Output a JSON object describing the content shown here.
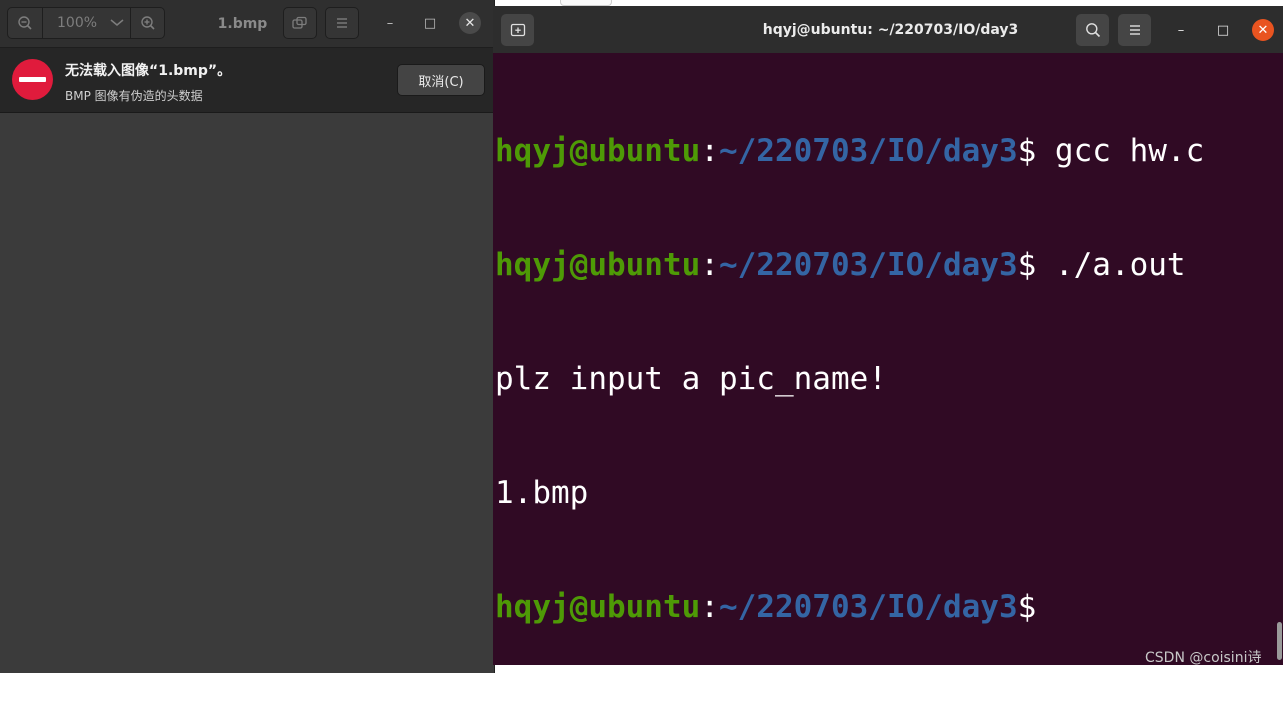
{
  "viewer": {
    "zoom_level": "100%",
    "title": "1.bmp",
    "error": {
      "title": "无法载入图像“1.bmp”。",
      "message": "BMP 图像有伪造的头数据",
      "cancel_label": "取消(C)"
    },
    "controls": {
      "minimize": "–",
      "maximize": "□",
      "close": "✕"
    }
  },
  "terminal": {
    "title": "hqyj@ubuntu: ~/220703/IO/day3",
    "prompt_user": "hqyj@ubuntu",
    "prompt_colon": ":",
    "prompt_path": "~/220703/IO/day3",
    "lines": [
      {
        "type": "prompt",
        "cmd": "$ gcc hw.c"
      },
      {
        "type": "prompt",
        "cmd": "$ ./a.out"
      },
      {
        "type": "output",
        "text": "plz input a pic_name!"
      },
      {
        "type": "output",
        "text": "1.bmp"
      },
      {
        "type": "prompt",
        "cmd": "$"
      }
    ],
    "controls": {
      "minimize": "–",
      "maximize": "□",
      "close": "✕"
    }
  },
  "watermark": "CSDN @coisini诗",
  "colors": {
    "terminal_bg": "#300a24",
    "prompt_user": "#4e9a06",
    "prompt_path": "#3465a4",
    "error_icon": "#e01b3c",
    "terminal_close": "#e95420"
  }
}
